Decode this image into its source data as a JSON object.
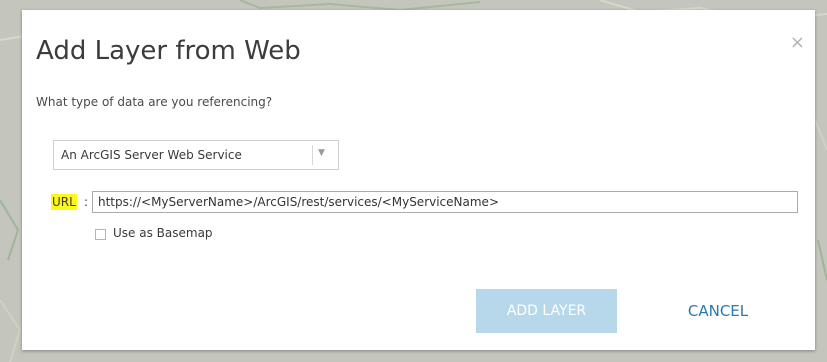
{
  "dialog": {
    "title": "Add Layer from Web",
    "close_glyph": "×",
    "question": "What type of data are you referencing?",
    "data_type_select": {
      "selected": "An ArcGIS Server Web Service",
      "arrow_icon": "chevron-down-icon"
    },
    "url": {
      "label": "URL",
      "colon": ":",
      "value": "https://<MyServerName>/ArcGIS/rest/services/<MyServiceName>",
      "label_highlight_color": "#fff71a"
    },
    "basemap_checkbox": {
      "label": "Use as Basemap",
      "checked": false
    },
    "buttons": {
      "add_layer": "ADD LAYER",
      "cancel": "CANCEL"
    }
  },
  "colors": {
    "accent": "#2a7ab0",
    "add_button_disabled_bg": "#b7d8ea"
  }
}
